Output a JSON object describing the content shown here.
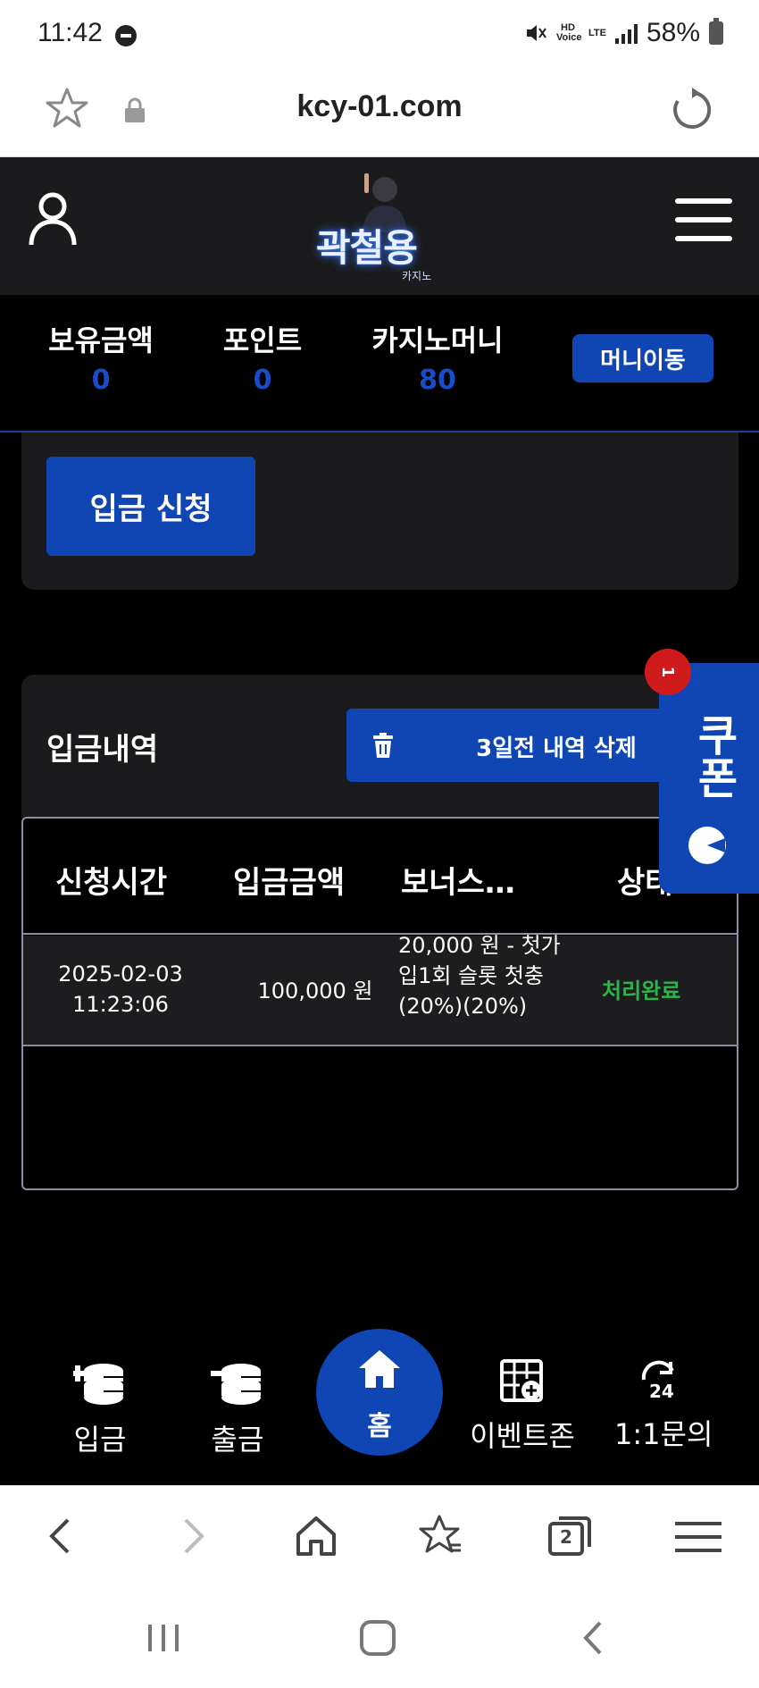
{
  "status_bar": {
    "time": "11:42",
    "network": "LTE",
    "hd_voice": "HD Voice",
    "battery": "58%"
  },
  "browser": {
    "url": "kcy-01.com"
  },
  "header": {
    "logo_text": "곽철용",
    "logo_sub": "카지노"
  },
  "balance": {
    "items": [
      {
        "label": "보유금액",
        "value": "0"
      },
      {
        "label": "포인트",
        "value": "0"
      },
      {
        "label": "카지노머니",
        "value": "80"
      }
    ],
    "move_button": "머니이동"
  },
  "deposit": {
    "apply_button": "입금 신청"
  },
  "history": {
    "title": "입금내역",
    "delete_button": "3일전 내역 삭제",
    "columns": [
      "신청시간",
      "입금금액",
      "보너스…",
      "상태"
    ],
    "rows": [
      {
        "time": "2025-02-03 11:23:06",
        "amount": "100,000 원",
        "bonus": "20,000 원 - 첫가입1회 슬롯 첫충(20%)(20%)",
        "status": "처리완료"
      }
    ]
  },
  "coupon": {
    "label": "쿠폰",
    "badge": "1"
  },
  "bottom_nav": {
    "items": [
      "입금",
      "출금",
      "홈",
      "이벤트존",
      "1:1문의"
    ]
  },
  "browser_toolbar": {
    "tabs_count": "2"
  },
  "colors": {
    "accent": "#0f46b3",
    "success": "#2fb24a",
    "badge": "#cf1b1b",
    "panel": "#1b1b1d"
  }
}
